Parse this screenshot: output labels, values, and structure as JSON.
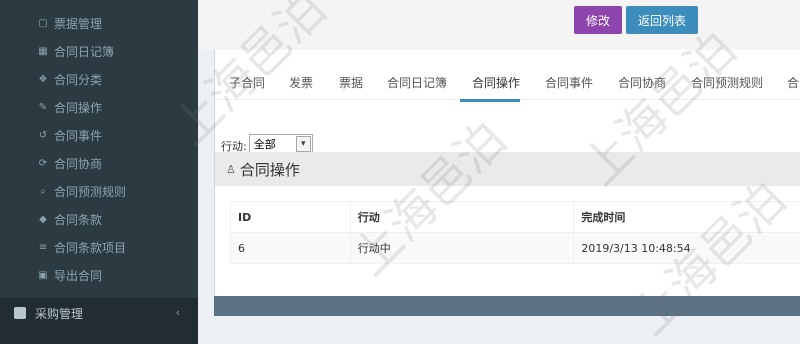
{
  "sidebar": {
    "items": [
      {
        "label": "票据管理",
        "icon": "book-icon"
      },
      {
        "label": "合同日记簿",
        "icon": "calendar-icon"
      },
      {
        "label": "合同分类",
        "icon": "cubes-icon"
      },
      {
        "label": "合同操作",
        "icon": "edit-icon"
      },
      {
        "label": "合同事件",
        "icon": "history-icon"
      },
      {
        "label": "合同协商",
        "icon": "refresh-icon"
      },
      {
        "label": "合同预测规则",
        "icon": "search-icon"
      },
      {
        "label": "合同条款",
        "icon": "tag-icon"
      },
      {
        "label": "合同条款项目",
        "icon": "list-icon"
      },
      {
        "label": "导出合同",
        "icon": "image-icon"
      }
    ],
    "parent": {
      "label": "采购管理",
      "icon": "table-icon"
    }
  },
  "topbar": {
    "edit_label": "修改",
    "back_label": "返回列表"
  },
  "tabs": [
    {
      "label": "子合同"
    },
    {
      "label": "发票"
    },
    {
      "label": "票据"
    },
    {
      "label": "合同日记簿"
    },
    {
      "label": "合同操作",
      "active": true
    },
    {
      "label": "合同事件"
    },
    {
      "label": "合同协商"
    },
    {
      "label": "合同预测规则"
    },
    {
      "label": "合"
    }
  ],
  "filter": {
    "label": "行动:",
    "value": "全部"
  },
  "section": {
    "title": "合同操作",
    "icon": "user-icon"
  },
  "table": {
    "headers": [
      "ID",
      "行动",
      "完成时间"
    ],
    "rows": [
      [
        "6",
        "行动中",
        "2019/3/13 10:48:54"
      ]
    ]
  },
  "watermark": "上海邑泊",
  "colors": {
    "sidebar": "#2c3b41",
    "edit_button": "#8e44ad",
    "back_button": "#3c8dbc",
    "footer_bar": "#5b7184"
  }
}
